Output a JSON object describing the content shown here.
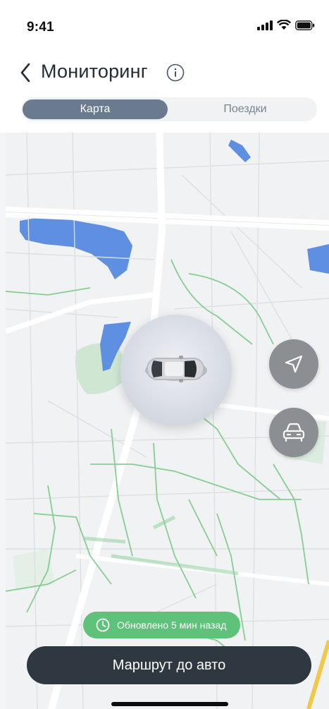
{
  "status_bar": {
    "time": "9:41",
    "icons": [
      "signal-icon",
      "wifi-icon",
      "battery-icon"
    ]
  },
  "header": {
    "title": "Мониторинг",
    "back_icon": "chevron-left-icon",
    "info_icon": "info-icon"
  },
  "tabs": [
    {
      "label": "Карта",
      "selected": true
    },
    {
      "label": "Поездки",
      "selected": false
    }
  ],
  "map": {
    "car_icon": "car-top-view-icon",
    "buttons": [
      {
        "name": "navigation-arrow-icon"
      },
      {
        "name": "car-front-icon"
      }
    ],
    "updated_badge": {
      "icon": "clock-icon",
      "text": "Обновлено 5 мин назад"
    },
    "route_button": {
      "label": "Маршрут до авто"
    }
  },
  "colors": {
    "tab_selected": "#6b7b8f",
    "badge": "#5fc27a",
    "primary_button": "#2f3840",
    "map_button": "#8b8e93",
    "water": "#5f8fe0",
    "park": "#b8ddbf",
    "route_line": "#7cc98a"
  }
}
